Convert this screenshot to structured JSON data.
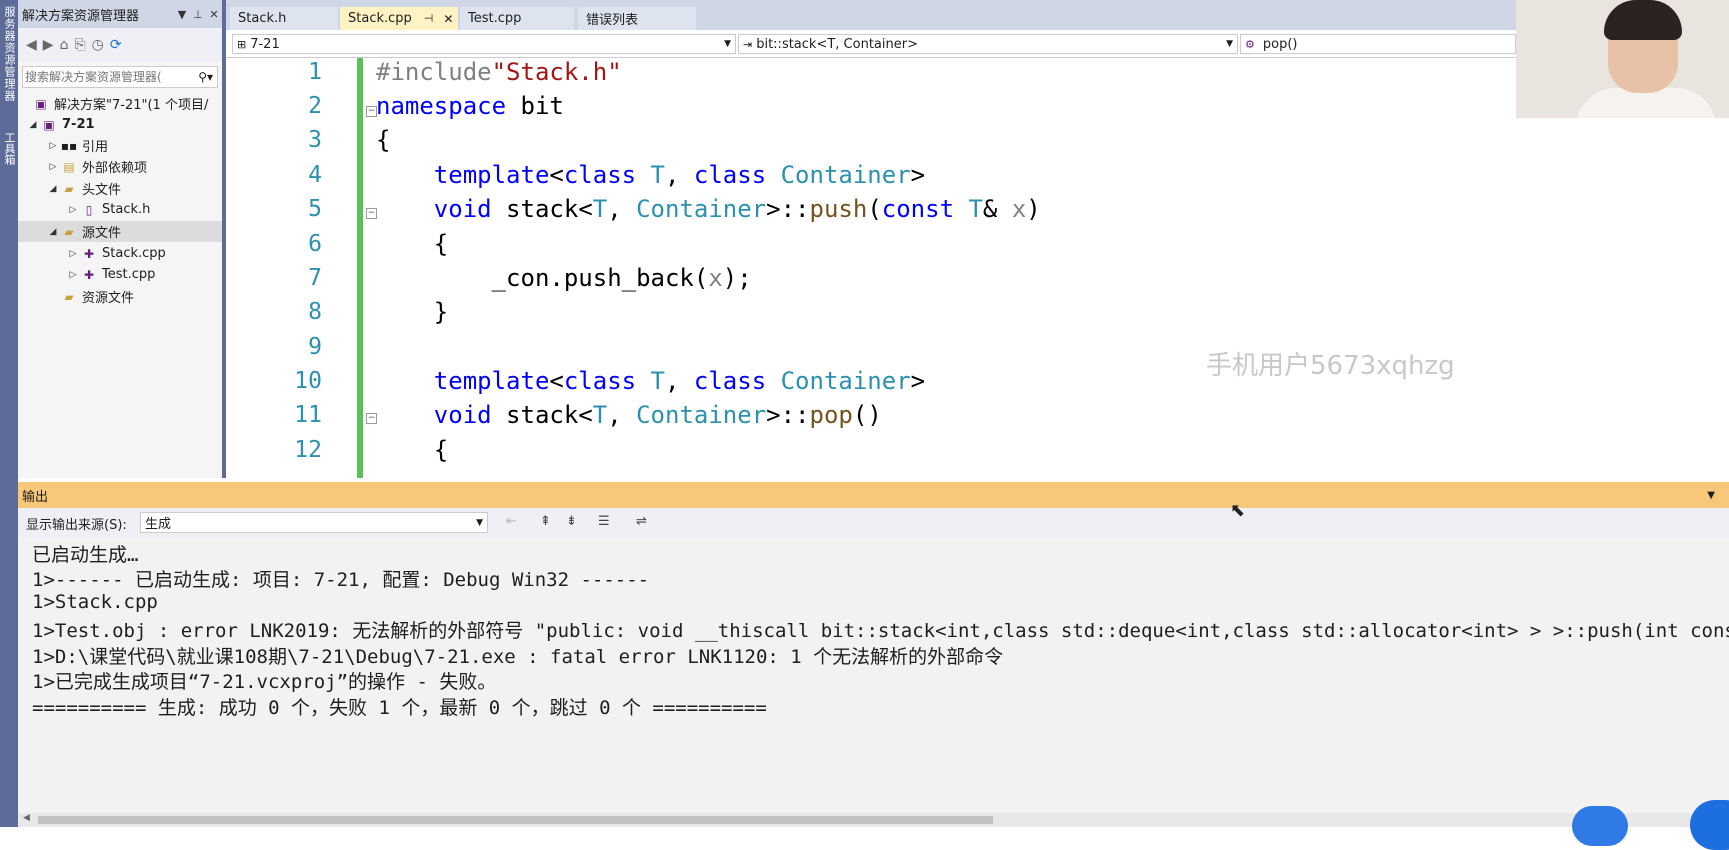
{
  "window": {
    "left_strip_text": "服务器资源管理器",
    "left_strip_text2": "工具箱"
  },
  "solution_explorer": {
    "title": "解决方案资源管理器",
    "search_placeholder": "搜索解决方案资源管理器(",
    "items": [
      {
        "label": "解决方案\"7-21\"(1 个项目/",
        "icon": "solution-icon"
      },
      {
        "label": "7-21",
        "icon": "project-icon"
      },
      {
        "label": "引用",
        "icon": "references-icon"
      },
      {
        "label": "外部依赖项",
        "icon": "external-deps-icon"
      },
      {
        "label": "头文件",
        "icon": "folder-icon"
      },
      {
        "label": "Stack.h",
        "icon": "header-file-icon"
      },
      {
        "label": "源文件",
        "icon": "folder-icon"
      },
      {
        "label": "Stack.cpp",
        "icon": "cpp-file-icon"
      },
      {
        "label": "Test.cpp",
        "icon": "cpp-file-icon"
      },
      {
        "label": "资源文件",
        "icon": "folder-icon"
      }
    ]
  },
  "tabs": [
    {
      "label": "Stack.h",
      "active": false
    },
    {
      "label": "Stack.cpp",
      "active": true
    },
    {
      "label": "Test.cpp",
      "active": false
    },
    {
      "label": "错误列表",
      "active": false
    }
  ],
  "nav": {
    "project": "7-21",
    "scope": "bit::stack<T, Container>",
    "member": "pop()"
  },
  "code_lines": [
    "1",
    "2",
    "3",
    "4",
    "5",
    "6",
    "7",
    "8",
    "9",
    "10",
    "11",
    "12"
  ],
  "watermark": "手机用户5673xqhzg",
  "output": {
    "title": "输出",
    "source_label": "显示输出来源(S):",
    "source_value": "生成",
    "lines": [
      "已启动生成…",
      "1>------ 已启动生成: 项目: 7-21, 配置: Debug Win32 ------",
      "1>Stack.cpp",
      "1>Test.obj : error LNK2019: 无法解析的外部符号 \"public: void __thiscall bit::stack<int,class std::deque<int,class std::allocator<int> > >::push(int cons",
      "1>D:\\课堂代码\\就业课108期\\7-21\\Debug\\7-21.exe : fatal error LNK1120: 1 个无法解析的外部命令",
      "1>已完成生成项目“7-21.vcxproj”的操作 - 失败。",
      "========== 生成: 成功 0 个，失败 1 个，最新 0 个，跳过 0 个 =========="
    ]
  },
  "colors": {
    "accent": "#5d6b99",
    "output_title": "#f7c87a",
    "change_bar": "#57c15a"
  }
}
